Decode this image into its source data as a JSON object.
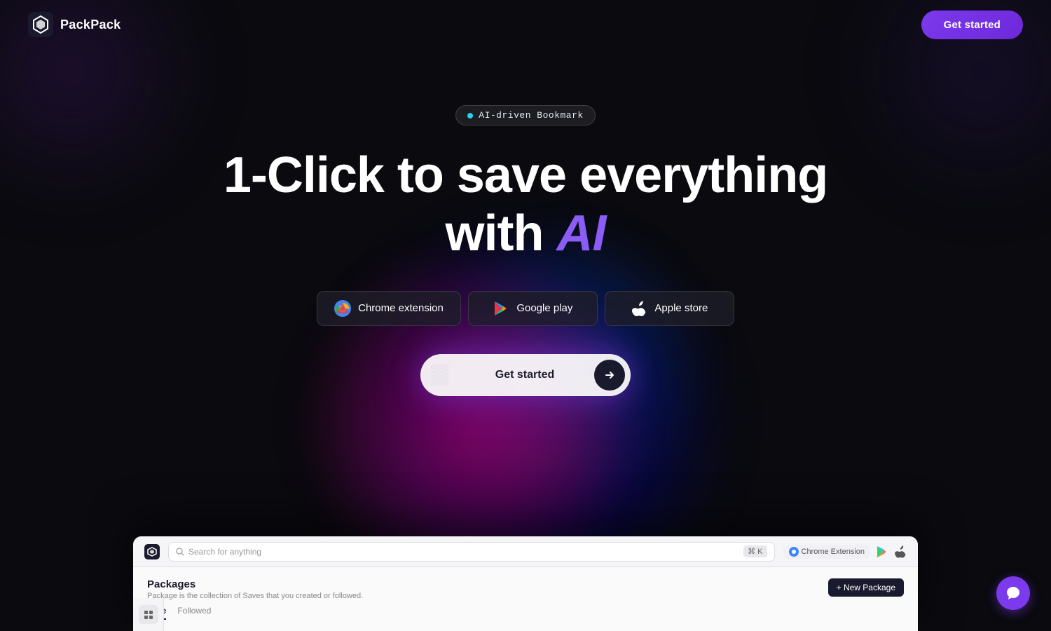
{
  "brand": {
    "name": "PackPack",
    "logo_alt": "PackPack logo"
  },
  "navbar": {
    "get_started_label": "Get started"
  },
  "hero": {
    "badge_text": "AI-driven Bookmark",
    "title_part1": "1-Click to save everything",
    "title_part2": "with ",
    "title_ai": "AI",
    "buttons": [
      {
        "id": "chrome",
        "label": "Chrome extension",
        "icon": "chrome-icon"
      },
      {
        "id": "google-play",
        "label": "Google play",
        "icon": "play-icon"
      },
      {
        "id": "apple-store",
        "label": "Apple store",
        "icon": "apple-icon"
      }
    ],
    "cta_label": "Get started"
  },
  "app_preview": {
    "search_placeholder": "Search for anything",
    "search_shortcut": "⌘ K",
    "chrome_ext_label": "Chrome Extension",
    "packages_title": "Packages",
    "packages_desc": "Package is the collection of Saves that you created or followed.",
    "new_package_label": "+ New Package",
    "tabs": [
      {
        "label": "Mine",
        "active": true
      },
      {
        "label": "Followed",
        "active": false
      }
    ]
  },
  "chat_bubble": {
    "icon": "chat-icon"
  }
}
